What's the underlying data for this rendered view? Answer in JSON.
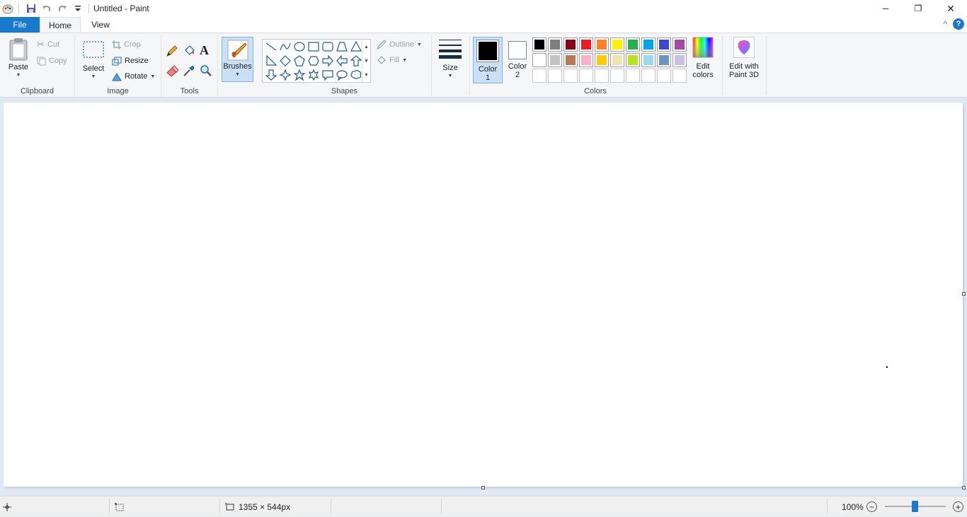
{
  "window": {
    "title": "Untitled - Paint",
    "minimize_glyph": "─",
    "restore_glyph": "❐",
    "close_glyph": "✕"
  },
  "tabs": {
    "file": "File",
    "home": "Home",
    "view": "View",
    "collapse_glyph": "^",
    "help_glyph": "?"
  },
  "clipboard": {
    "paste_label": "Paste",
    "cut_label": "Cut",
    "copy_label": "Copy",
    "group_label": "Clipboard"
  },
  "image": {
    "select_label": "Select",
    "crop_label": "Crop",
    "resize_label": "Resize",
    "rotate_label": "Rotate",
    "group_label": "Image"
  },
  "tools": {
    "group_label": "Tools"
  },
  "brushes": {
    "label": "Brushes"
  },
  "shapes": {
    "outline_label": "Outline",
    "fill_label": "Fill",
    "group_label": "Shapes"
  },
  "size": {
    "label": "Size"
  },
  "colors": {
    "color1_label": "Color 1",
    "color2_label": "Color 2",
    "edit_colors_label": "Edit colors",
    "group_label": "Colors",
    "color1_value": "#000000",
    "color2_value": "#ffffff",
    "palette_row1": [
      "#000000",
      "#7f7f7f",
      "#880015",
      "#ed1c24",
      "#ff7f27",
      "#fff200",
      "#22b14c",
      "#00a2e8",
      "#3f48cc",
      "#a349a4"
    ],
    "palette_row2": [
      "#ffffff",
      "#c3c3c3",
      "#b97a57",
      "#ffaec9",
      "#ffc90e",
      "#efe4b0",
      "#b5e61d",
      "#99d9ea",
      "#7092be",
      "#c8bfe7"
    ]
  },
  "paint3d": {
    "label": "Edit with Paint 3D"
  },
  "statusbar": {
    "dimensions": "1355 × 544px",
    "zoom": "100%",
    "zoom_out_glyph": "−",
    "zoom_in_glyph": "+"
  }
}
